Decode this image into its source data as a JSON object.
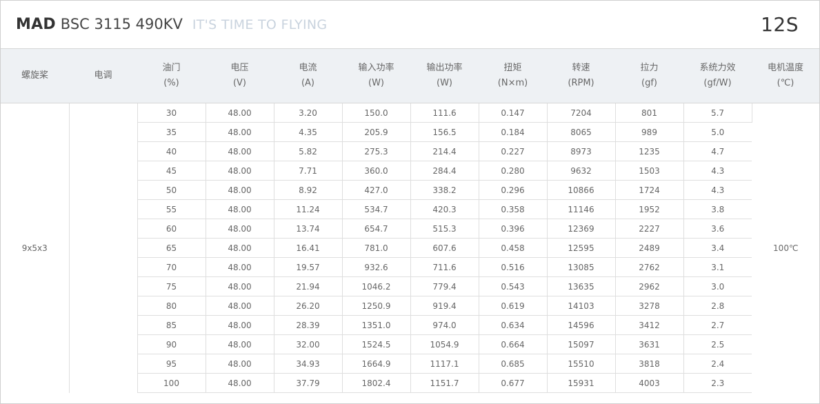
{
  "header": {
    "brand": "MAD",
    "model": "BSC 3115 490KV",
    "slogan": "IT'S TIME TO FLYING",
    "cells": "12S"
  },
  "table": {
    "columns": [
      {
        "name": "螺旋桨",
        "unit": ""
      },
      {
        "name": "电调",
        "unit": ""
      },
      {
        "name": "油门",
        "unit": "(%)"
      },
      {
        "name": "电压",
        "unit": "(V)"
      },
      {
        "name": "电流",
        "unit": "(A)"
      },
      {
        "name": "输入功率",
        "unit": "(W)"
      },
      {
        "name": "输出功率",
        "unit": "(W)"
      },
      {
        "name": "扭矩",
        "unit": "(N×m)"
      },
      {
        "name": "转速",
        "unit": "(RPM)"
      },
      {
        "name": "拉力",
        "unit": "(gf)"
      },
      {
        "name": "系统力效",
        "unit": "(gf/W)"
      },
      {
        "name": "电机温度",
        "unit": "(℃)"
      }
    ],
    "propeller": "9x5x3",
    "esc": "",
    "motor_temp": "100℃",
    "rows": [
      [
        "30",
        "48.00",
        "3.20",
        "150.0",
        "111.6",
        "0.147",
        "7204",
        "801",
        "5.7"
      ],
      [
        "35",
        "48.00",
        "4.35",
        "205.9",
        "156.5",
        "0.184",
        "8065",
        "989",
        "5.0"
      ],
      [
        "40",
        "48.00",
        "5.82",
        "275.3",
        "214.4",
        "0.227",
        "8973",
        "1235",
        "4.7"
      ],
      [
        "45",
        "48.00",
        "7.71",
        "360.0",
        "284.4",
        "0.280",
        "9632",
        "1503",
        "4.3"
      ],
      [
        "50",
        "48.00",
        "8.92",
        "427.0",
        "338.2",
        "0.296",
        "10866",
        "1724",
        "4.3"
      ],
      [
        "55",
        "48.00",
        "11.24",
        "534.7",
        "420.3",
        "0.358",
        "11146",
        "1952",
        "3.8"
      ],
      [
        "60",
        "48.00",
        "13.74",
        "654.7",
        "515.3",
        "0.396",
        "12369",
        "2227",
        "3.6"
      ],
      [
        "65",
        "48.00",
        "16.41",
        "781.0",
        "607.6",
        "0.458",
        "12595",
        "2489",
        "3.4"
      ],
      [
        "70",
        "48.00",
        "19.57",
        "932.6",
        "711.6",
        "0.516",
        "13085",
        "2762",
        "3.1"
      ],
      [
        "75",
        "48.00",
        "21.94",
        "1046.2",
        "779.4",
        "0.543",
        "13635",
        "2962",
        "3.0"
      ],
      [
        "80",
        "48.00",
        "26.20",
        "1250.9",
        "919.4",
        "0.619",
        "14103",
        "3278",
        "2.8"
      ],
      [
        "85",
        "48.00",
        "28.39",
        "1351.0",
        "974.0",
        "0.634",
        "14596",
        "3412",
        "2.7"
      ],
      [
        "90",
        "48.00",
        "32.00",
        "1524.5",
        "1054.9",
        "0.664",
        "15097",
        "3631",
        "2.5"
      ],
      [
        "95",
        "48.00",
        "34.93",
        "1664.9",
        "1117.1",
        "0.685",
        "15510",
        "3818",
        "2.4"
      ],
      [
        "100",
        "48.00",
        "37.79",
        "1802.4",
        "1151.7",
        "0.677",
        "15931",
        "4003",
        "2.3"
      ]
    ]
  }
}
